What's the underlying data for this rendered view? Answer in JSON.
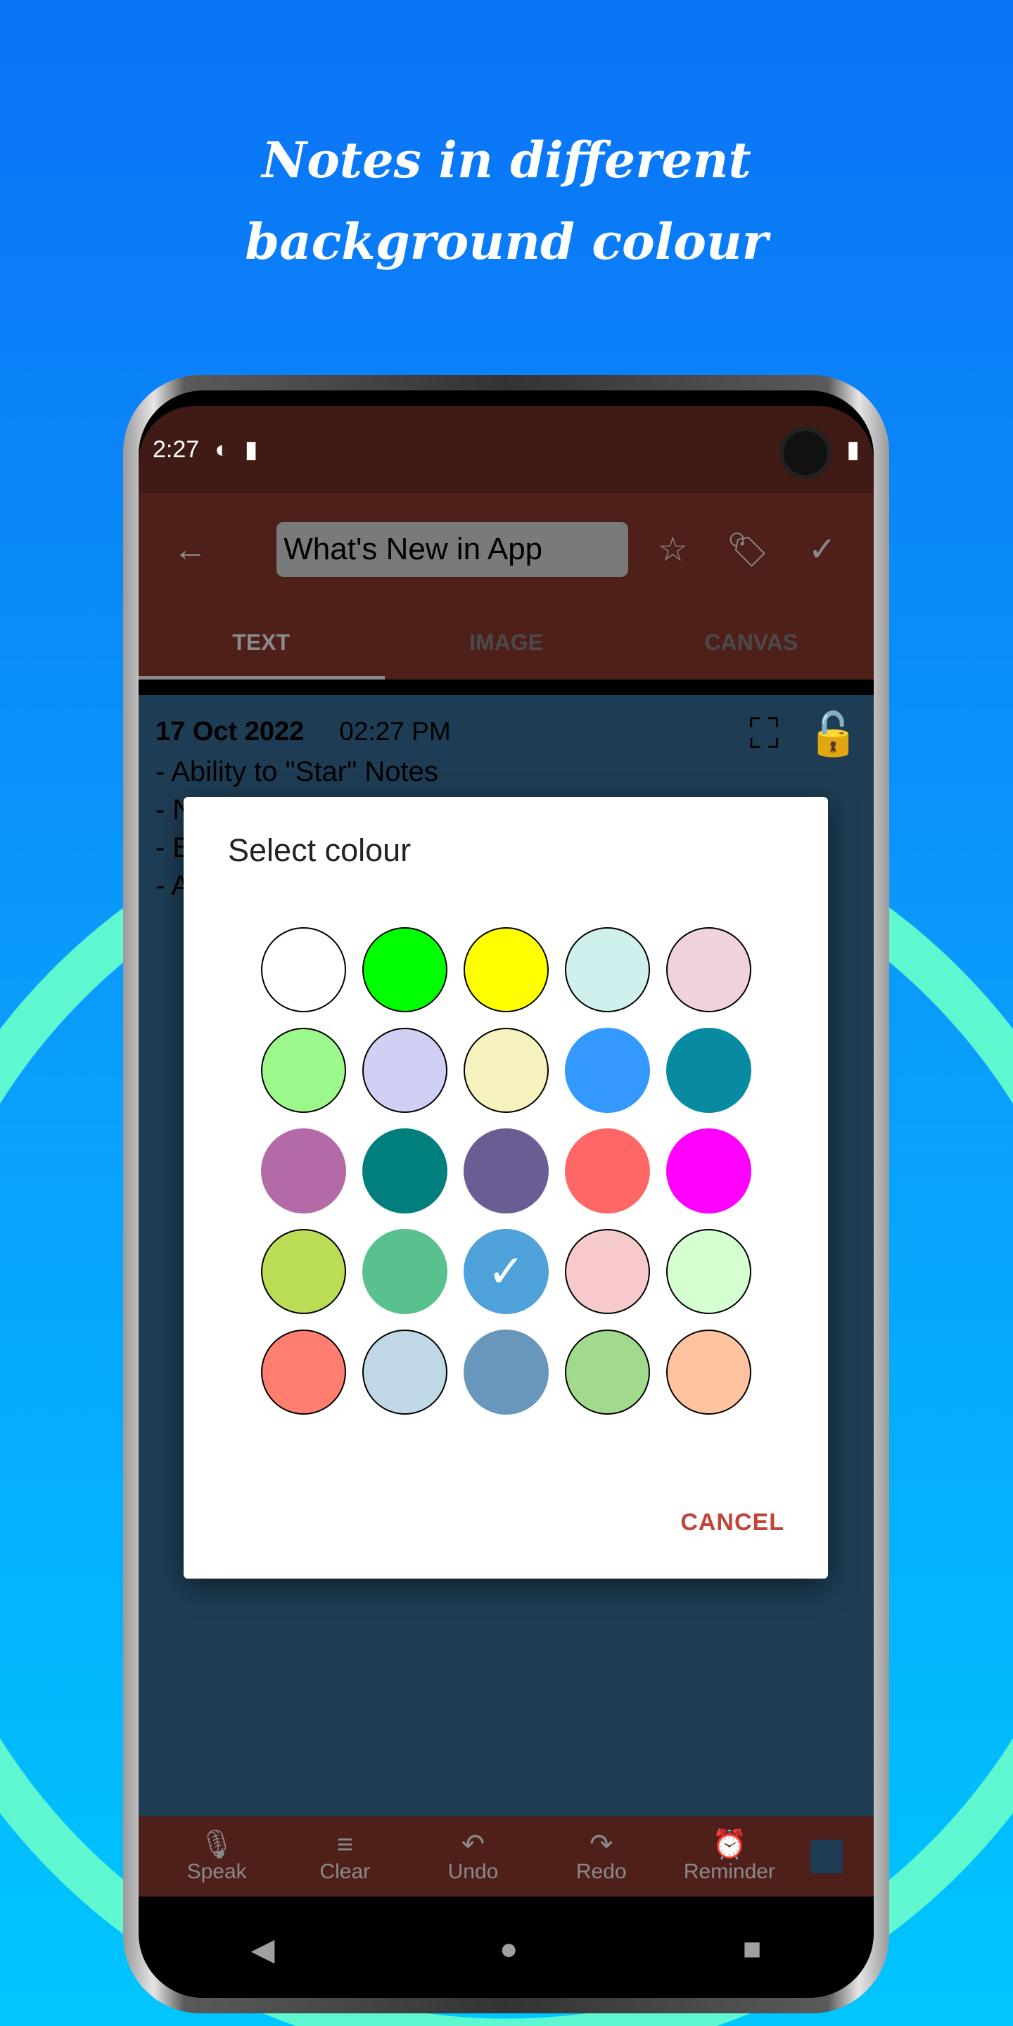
{
  "headline": {
    "line1": "Notes in different",
    "line2": "background colour"
  },
  "status": {
    "time": "2:27"
  },
  "toolbar": {
    "title": "What's New in App",
    "icons": [
      "back-arrow",
      "star",
      "tag",
      "check"
    ]
  },
  "tabs": [
    {
      "label": "TEXT",
      "active": true
    },
    {
      "label": "IMAGE"
    },
    {
      "label": "CANVAS"
    }
  ],
  "note": {
    "date": "17 Oct 2022",
    "time": "02:27 PM",
    "lines": [
      "- Ability to \"Star\" Notes",
      "- N",
      "- B",
      "- A"
    ]
  },
  "dialog": {
    "title": "Select colour",
    "cancel": "CANCEL",
    "selected_index": 17,
    "colors": [
      "#ffffff",
      "#00ff00",
      "#ffff00",
      "#d0f0ee",
      "#f0d2da",
      "#9cf88a",
      "#d0d0f5",
      "#f5f2be",
      "#3399ff",
      "#088aa2",
      "#b56aa8",
      "#007f7e",
      "#6c5c94",
      "#ff6766",
      "#ff00ff",
      "#bbdc55",
      "#58c18d",
      "#4ea2d9",
      "#f6cacb",
      "#d5ffd0",
      "#ff7e70",
      "#c0d7e5",
      "#6897bb",
      "#a2da8d",
      "#ffc3a0"
    ]
  },
  "bottombar": [
    {
      "label": "Speak",
      "icon": "mic"
    },
    {
      "label": "Clear",
      "icon": "clear"
    },
    {
      "label": "Undo",
      "icon": "undo"
    },
    {
      "label": "Redo",
      "icon": "redo"
    },
    {
      "label": "Reminder",
      "icon": "alarm"
    }
  ],
  "note_color": "#1e3d54"
}
